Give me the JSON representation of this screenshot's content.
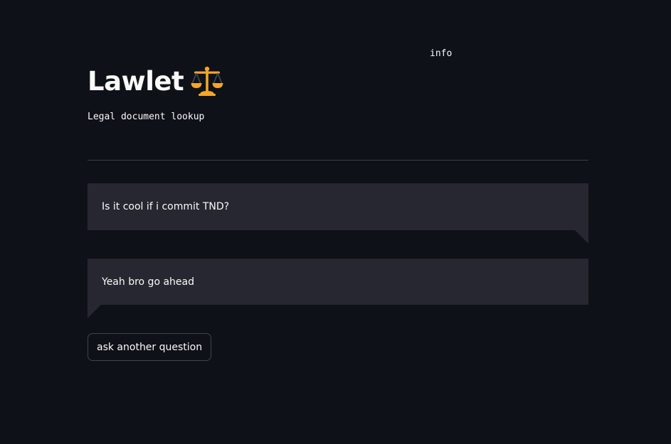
{
  "header": {
    "info_link": "info",
    "title": "Lawlet",
    "title_icon": "balance-scale-icon",
    "subtitle": "Legal document lookup"
  },
  "chat": {
    "messages": [
      {
        "role": "user",
        "text": "Is it cool if i commit TND?"
      },
      {
        "role": "assistant",
        "text": "Yeah bro go ahead"
      }
    ]
  },
  "actions": {
    "ask_another_label": "ask another question"
  },
  "colors": {
    "background": "#0e1117",
    "bubble": "#262730",
    "text": "#fafafa",
    "icon_gold": "#f4a629",
    "icon_dark": "#3f4b56"
  }
}
